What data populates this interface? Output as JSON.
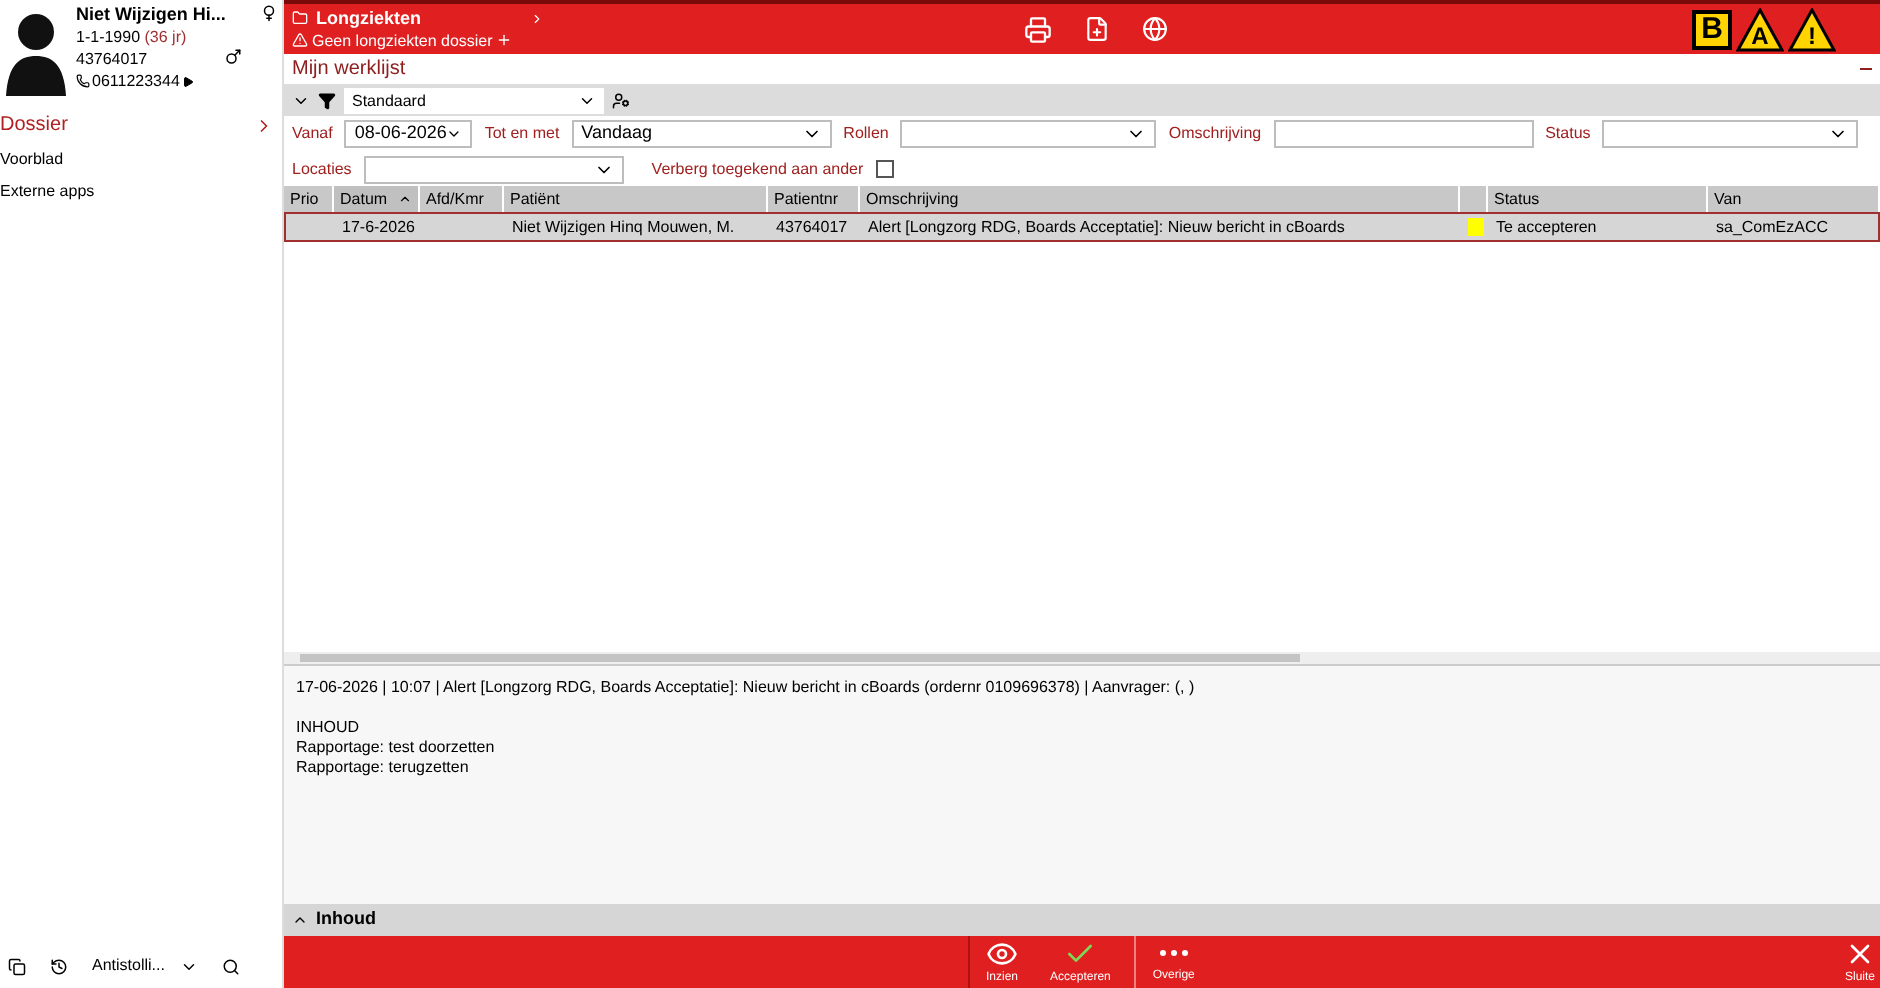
{
  "patient": {
    "name": "Niet Wijzigen Hi...",
    "dob": "1-1-1990",
    "age": "(36 jr)",
    "number": "43764017",
    "phone": "0611223344"
  },
  "sidebar": {
    "header": "Dossier",
    "items": [
      {
        "label": "Voorblad"
      },
      {
        "label": "Externe apps"
      }
    ],
    "bottom_dropdown": "Antistolli..."
  },
  "topbar": {
    "category": "Longziekten",
    "warning": "Geen longziekten dossier",
    "badges": [
      {
        "kind": "square",
        "label": "B"
      },
      {
        "kind": "triangle",
        "label": "A"
      },
      {
        "kind": "triangle",
        "label": "!"
      }
    ]
  },
  "worklist": {
    "title": "Mijn werklijst",
    "filter": "Standaard",
    "filters": [
      {
        "label": "Vanaf",
        "kind": "date",
        "value": "08-06-2026"
      },
      {
        "label": "Tot en met",
        "kind": "select",
        "value": "Vandaag"
      },
      {
        "label": "Rollen",
        "kind": "select"
      },
      {
        "label": "Omschrijving",
        "kind": "text"
      },
      {
        "label": "Status",
        "kind": "select"
      }
    ],
    "locaties": {
      "label": "Locaties"
    },
    "hide_assigned": {
      "label": "Verberg toegekend aan ander",
      "checked": false
    }
  },
  "table": {
    "columns": [
      {
        "label": "Prio",
        "sorted": false
      },
      {
        "label": "Datum",
        "sorted": true
      },
      {
        "label": "Afd/Kmr",
        "sorted": false
      },
      {
        "label": "Patiënt",
        "sorted": false
      },
      {
        "label": "Patientnr",
        "sorted": false
      },
      {
        "label": "Omschrijving",
        "sorted": false
      },
      {
        "sorted": false
      },
      {
        "label": "Status",
        "sorted": false
      },
      {
        "label": "Van",
        "sorted": false
      }
    ],
    "rows": [
      {
        "selected": true,
        "color": "#ffff00",
        "cells": [
          null,
          "17-6-2026",
          null,
          "Niet Wijzigen Hinq Mouwen, M.",
          "43764017",
          "Alert [Longzorg RDG, Boards Acceptatie]: Nieuw bericht in cBoards",
          null,
          "Te accepteren",
          "sa_ComEzACC"
        ]
      }
    ]
  },
  "detail": {
    "header": "17-06-2026 | 10:07 |  Alert [Longzorg RDG, Boards Acceptatie]: Nieuw bericht in cBoards (ordernr 0109696378) | Aanvrager:  (, )",
    "lines": [
      "INHOUD",
      "Rapportage: test doorzetten",
      "Rapportage: terugzetten"
    ]
  },
  "section": {
    "label": "Inhoud"
  },
  "actions": [
    {
      "kind": "eye",
      "label": "Inzien"
    },
    {
      "kind": "check",
      "label": "Accepteren"
    },
    {
      "kind": "more",
      "label": "Overige"
    }
  ],
  "close": {
    "label": "Sluite"
  }
}
